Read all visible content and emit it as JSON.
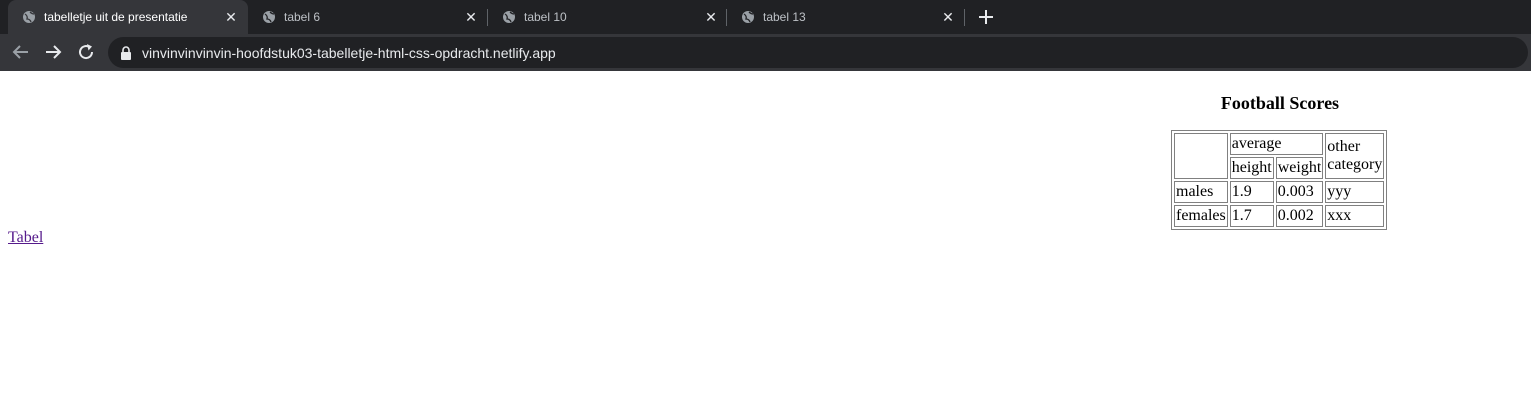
{
  "browser": {
    "tabs": [
      {
        "title": "tabelletje uit de presentatie",
        "active": true
      },
      {
        "title": "tabel 6",
        "active": false
      },
      {
        "title": "tabel 10",
        "active": false
      },
      {
        "title": "tabel 13",
        "active": false
      }
    ],
    "url": "vinvinvinvinvin-hoofdstuk03-tabelletje-html-css-opdracht.netlify.app"
  },
  "page": {
    "link_text": "Tabel",
    "table": {
      "caption": "Football Scores",
      "header_group": "average",
      "header_height": "height",
      "header_weight": "weight",
      "header_other": "other category",
      "rows": [
        {
          "label": "males",
          "height": "1.9",
          "weight": "0.003",
          "other": "yyy"
        },
        {
          "label": "females",
          "height": "1.7",
          "weight": "0.002",
          "other": "xxx"
        }
      ]
    }
  }
}
